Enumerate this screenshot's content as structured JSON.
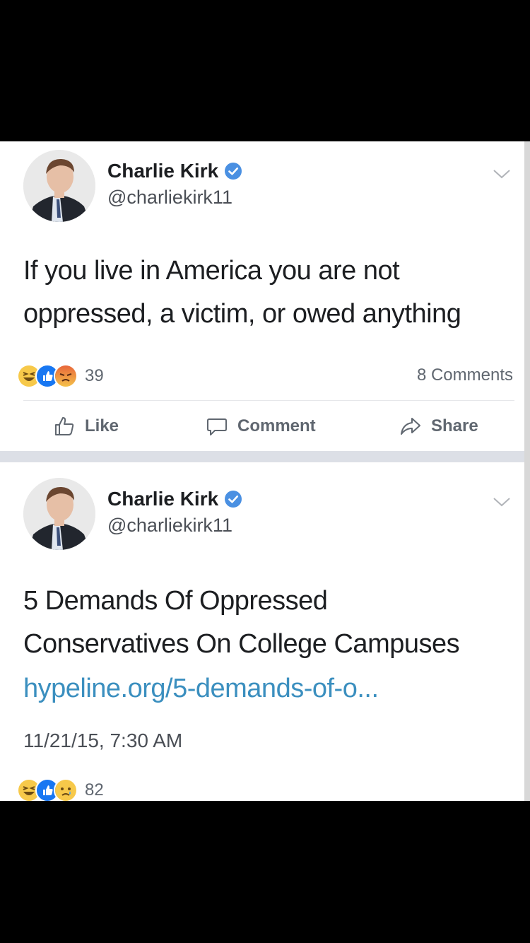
{
  "posts": [
    {
      "author": "Charlie Kirk",
      "handle": "@charliekirk11",
      "text_lines": [
        "If you live in America you are not",
        "oppressed, a victim, or owed anything"
      ],
      "reaction_icons": [
        "haha-icon",
        "like-icon",
        "angry-icon"
      ],
      "reaction_count": "39",
      "comments": "8 Comments",
      "actions": {
        "like": "Like",
        "comment": "Comment",
        "share": "Share"
      }
    },
    {
      "author": "Charlie Kirk",
      "handle": "@charliekirk11",
      "text_lines": [
        "5 Demands Of Oppressed",
        "Conservatives On College Campuses"
      ],
      "link": "hypeline.org/5-demands-of-o...",
      "timestamp": "11/21/15, 7:30 AM",
      "reaction_icons": [
        "haha-icon",
        "like-icon",
        "sad-icon"
      ],
      "reaction_count": "82"
    }
  ],
  "colors": {
    "verified": "#4a90e2",
    "link": "#3b8fbf",
    "like": "#1877f2",
    "haha": "#f7c94a",
    "angry": "#e8663a"
  }
}
